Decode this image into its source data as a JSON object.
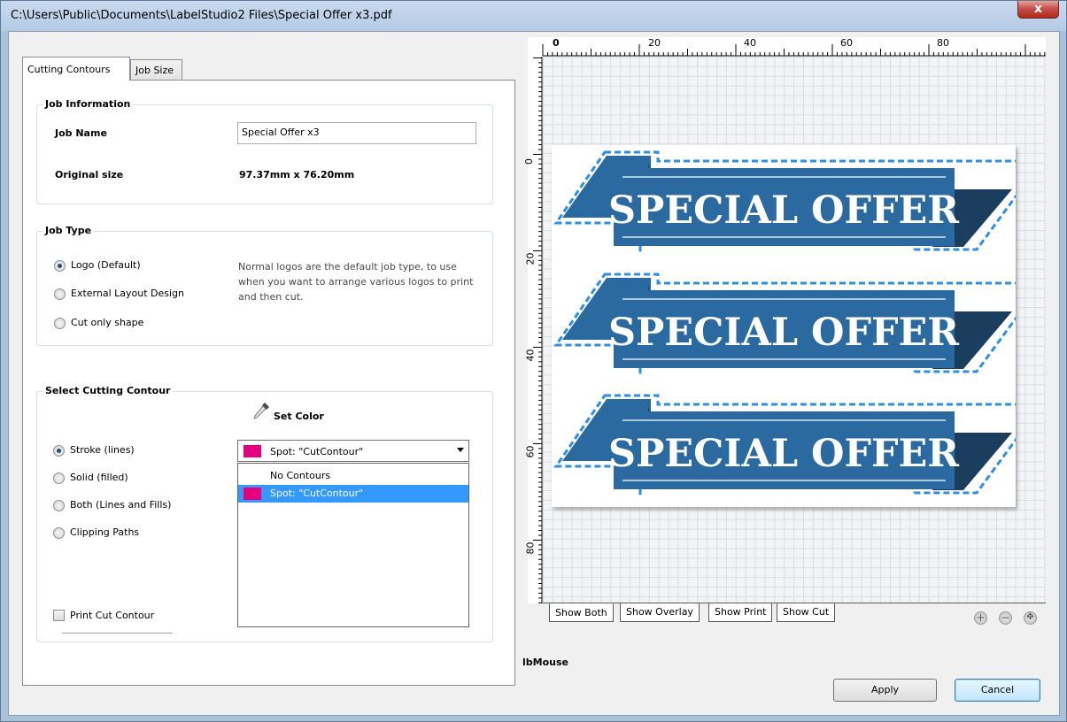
{
  "window": {
    "title": "C:\\Users\\Public\\Documents\\LabelStudio2 Files\\Special Offer x3.pdf",
    "close_label": "x"
  },
  "tabs": {
    "cutting_contours": "Cutting Contours",
    "job_size": "Job Size"
  },
  "job_information": {
    "title": "Job Information",
    "job_name_label": "Job Name",
    "job_name_value": "Special Offer x3",
    "original_size_label": "Original size",
    "original_size_value": "97.37mm x 76.20mm"
  },
  "job_type": {
    "title": "Job Type",
    "options": [
      "Logo (Default)",
      "External Layout Design",
      "Cut only shape"
    ],
    "selected": "Logo (Default)",
    "description": "Normal logos are the default job type, to use when you want to arrange various logos to print and then cut."
  },
  "cutting_contour": {
    "title": "Select Cutting Contour",
    "set_color_label": "Set Color",
    "options": [
      "Stroke (lines)",
      "Solid (filled)",
      "Both (Lines and Fills)",
      "Clipping Paths"
    ],
    "selected": "Stroke (lines)",
    "combo_value": "Spot: \"CutContour\"",
    "combo_swatch_color": "#e5007e",
    "dropdown_items": [
      "No Contours",
      "Spot: \"CutContour\""
    ],
    "dropdown_selected": "Spot: \"CutContour\"",
    "print_cut_contour_label": "Print Cut Contour"
  },
  "preview": {
    "ruler_top_labels": [
      "0",
      "20",
      "40",
      "60",
      "80"
    ],
    "ruler_left_labels": [
      "0",
      "20",
      "40",
      "60",
      "80"
    ],
    "banner_text": "SPECIAL OFFER",
    "banner_color": "#2b6aa0",
    "cut_line_color": "#2b8fea",
    "view_tabs": [
      "Show Both",
      "Show Overlay",
      "Show Print",
      "Show Cut"
    ],
    "active_view": "Show Both",
    "zoom_in_icon": "+",
    "zoom_out_icon": "−",
    "zoom_fit_icon": "✥"
  },
  "status": {
    "text": "lbMouse"
  },
  "buttons": {
    "apply": "Apply",
    "cancel": "Cancel"
  }
}
